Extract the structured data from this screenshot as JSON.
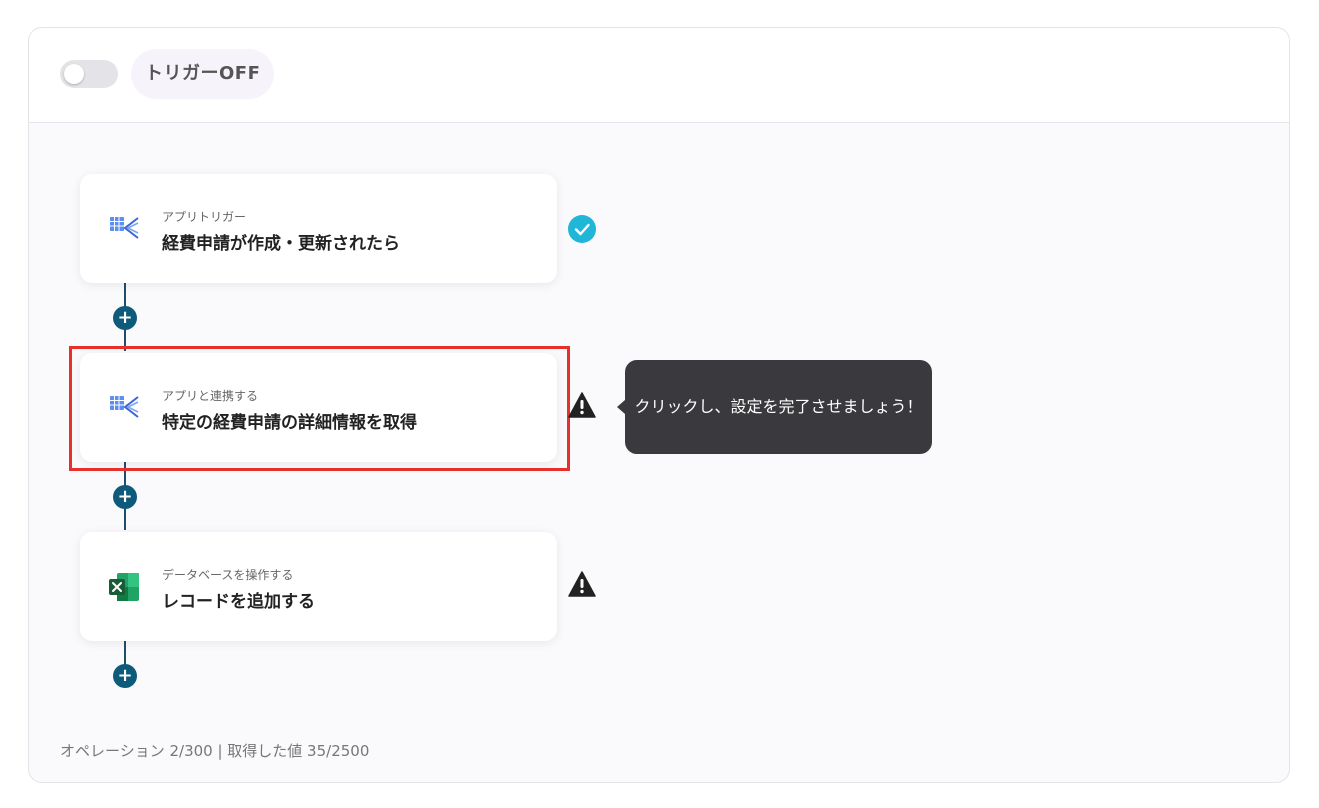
{
  "header": {
    "trigger_label": "トリガーOFF"
  },
  "steps": [
    {
      "subtitle": "アプリトリガー",
      "title": "経費申請が作成・更新されたら",
      "icon": "expense-app-icon",
      "status": "complete-check-icon"
    },
    {
      "subtitle": "アプリと連携する",
      "title": "特定の経費申請の詳細情報を取得",
      "icon": "expense-app-icon",
      "status": "warning-icon"
    },
    {
      "subtitle": "データベースを操作する",
      "title": "レコードを追加する",
      "icon": "excel-icon",
      "status": "warning-icon"
    }
  ],
  "tooltip": {
    "text": "クリックし、設定を完了させましょう！"
  },
  "footer": {
    "usage": "オペレーション 2/300 | 取得した値 35/2500"
  },
  "colors": {
    "accent_node": "#0e5a7a",
    "check": "#1fb6d8",
    "highlight": "#e8302a",
    "tooltip_bg": "#3a3a3e"
  }
}
